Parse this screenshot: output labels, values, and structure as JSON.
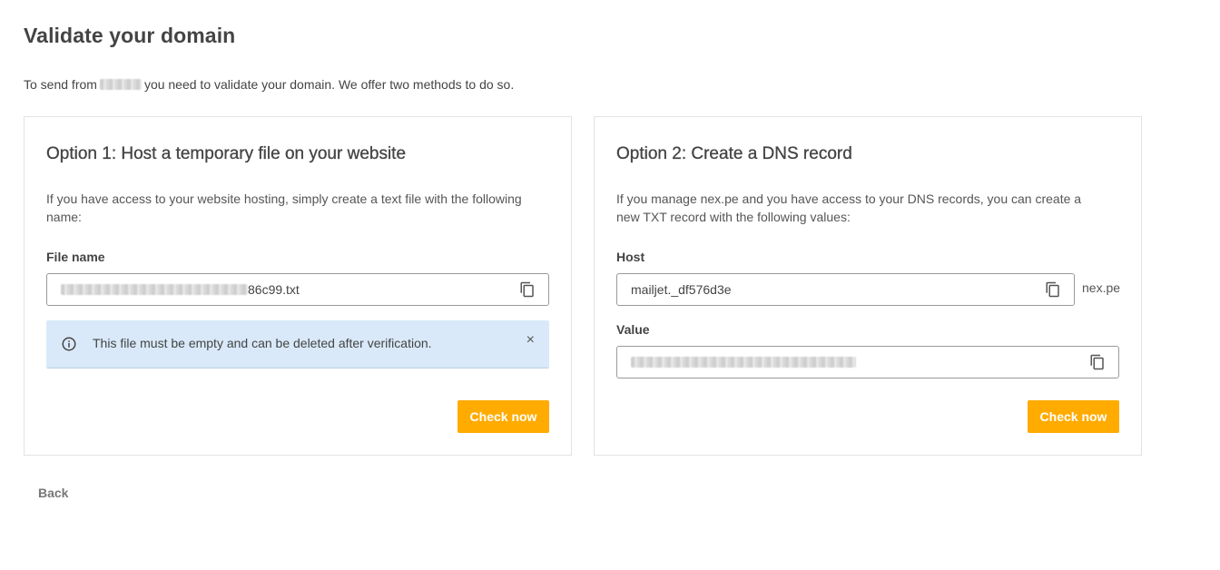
{
  "page": {
    "title": "Validate your domain",
    "intro_before": "To send from",
    "intro_after": "you need to validate your domain. We offer two methods to do so."
  },
  "option1": {
    "title": "Option 1: Host a temporary file on your website",
    "description": "If you have access to your website hosting, simply create a text file with the following name:",
    "file_label": "File name",
    "file_value_suffix": "86c99.txt",
    "alert_text": "This file must be empty and can be deleted after verification.",
    "alert_close": "×",
    "check_label": "Check now",
    "icons": {
      "copy": "copy-icon",
      "info": "info-icon",
      "close": "close-icon"
    }
  },
  "option2": {
    "title": "Option 2: Create a DNS record",
    "description": "If you manage nex.pe and you have access to your DNS records, you can create a new TXT record with the following values:",
    "host_label": "Host",
    "host_value": "mailjet._df576d3e",
    "host_suffix": "nex.pe",
    "value_label": "Value",
    "check_label": "Check now",
    "icons": {
      "copy": "copy-icon"
    }
  },
  "footer": {
    "back_label": "Back"
  },
  "colors": {
    "accent": "#ffab00",
    "alert_bg": "#d9e9f9",
    "text": "#444444",
    "border": "#e3e3e3"
  }
}
